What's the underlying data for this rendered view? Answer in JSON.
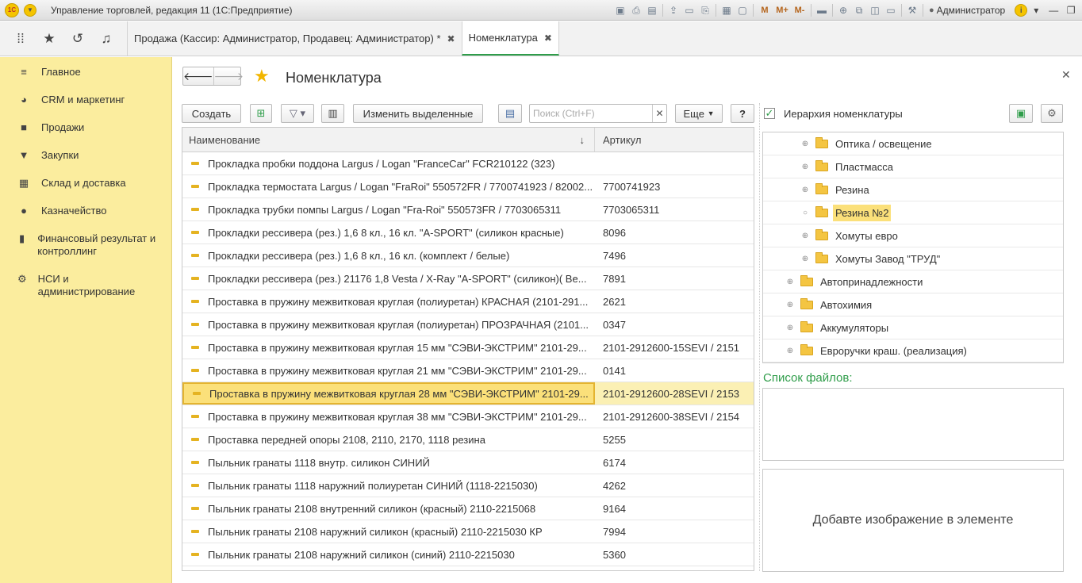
{
  "window": {
    "title": "Управление торговлей, редакция 11  (1С:Предприятие)",
    "user": "Администратор",
    "memory_buttons": [
      "M",
      "M+",
      "M-"
    ]
  },
  "tabs": [
    {
      "label": "Продажа (Кассир: Администратор, Продавец: Администратор) *",
      "active": false
    },
    {
      "label": "Номенклатура",
      "active": true
    }
  ],
  "sidebar": {
    "items": [
      {
        "label": "Главное",
        "icon": "hamburger-icon"
      },
      {
        "label": "CRM и маркетинг",
        "icon": "crm-icon"
      },
      {
        "label": "Продажи",
        "icon": "bag-icon"
      },
      {
        "label": "Закупки",
        "icon": "cart-icon"
      },
      {
        "label": "Склад и доставка",
        "icon": "grid-icon"
      },
      {
        "label": "Казначейство",
        "icon": "ruble-icon"
      },
      {
        "label": "Финансовый результат и контроллинг",
        "icon": "bar-chart-icon"
      },
      {
        "label": "НСИ и администрирование",
        "icon": "gear-icon"
      }
    ]
  },
  "page": {
    "title": "Номенклатура"
  },
  "toolbar": {
    "create_label": "Создать",
    "edit_selected_label": "Изменить выделенные",
    "more_label": "Еще",
    "help_label": "?",
    "search_placeholder": "Поиск (Ctrl+F)"
  },
  "table": {
    "columns": [
      "Наименование",
      "Артикул"
    ],
    "selected_index": 10,
    "rows": [
      {
        "name": "Прокладка пробки поддона Largus / Logan \"FranceCar\" FCR210122 (323)",
        "article": ""
      },
      {
        "name": "Прокладка термостата Largus / Logan \"FraRoi\" 550572FR / 7700741923 / 82002...",
        "article": "7700741923"
      },
      {
        "name": "Прокладка трубки помпы Largus / Logan \"Fra-Roi\" 550573FR / 7703065311",
        "article": "7703065311"
      },
      {
        "name": "Прокладки рессивера (рез.) 1,6 8 кл., 16 кл. \"A-SPORT\" (силикон красные)",
        "article": "8096"
      },
      {
        "name": "Прокладки рессивера (рез.) 1,6 8 кл., 16 кл. (комплект / белые)",
        "article": "7496"
      },
      {
        "name": "Прокладки рессивера (рез.) 21176 1,8 Vesta / X-Ray \"A-SPORT\" (силикон)( Ве...",
        "article": "7891"
      },
      {
        "name": "Проставка в пружину межвитковая круглая (полиуретан) КРАСНАЯ (2101-291...",
        "article": "2621"
      },
      {
        "name": "Проставка в пружину межвитковая круглая (полиуретан) ПРОЗРАЧНАЯ (2101...",
        "article": "0347"
      },
      {
        "name": "Проставка в пружину межвитковая круглая 15 мм \"СЭВИ-ЭКСТРИМ\" 2101-29...",
        "article": "2101-2912600-15SEVI / 2151"
      },
      {
        "name": "Проставка в пружину межвитковая круглая 21 мм \"СЭВИ-ЭКСТРИМ\" 2101-29...",
        "article": "0141"
      },
      {
        "name": "Проставка в пружину межвитковая круглая 28 мм \"СЭВИ-ЭКСТРИМ\" 2101-29...",
        "article": "2101-2912600-28SEVI / 2153"
      },
      {
        "name": "Проставка в пружину межвитковая круглая 38 мм \"СЭВИ-ЭКСТРИМ\" 2101-29...",
        "article": "2101-2912600-38SEVI / 2154"
      },
      {
        "name": "Проставка передней опоры 2108, 2110, 2170, 1118 резина",
        "article": "5255"
      },
      {
        "name": "Пыльник гранаты 1118 внутр. силикон СИНИЙ",
        "article": "6174"
      },
      {
        "name": "Пыльник гранаты 1118 наружний полиуретан СИНИЙ (1118-2215030)",
        "article": "4262"
      },
      {
        "name": "Пыльник гранаты 2108 внутренний силикон (красный) 2110-2215068",
        "article": "9164"
      },
      {
        "name": "Пыльник гранаты 2108 наружний силикон (красный) 2110-2215030 КР",
        "article": "7994"
      },
      {
        "name": "Пыльник гранаты 2108 наружний силикон (синий) 2110-2215030",
        "article": "5360"
      }
    ]
  },
  "hierarchy": {
    "label": "Иерархия номенклатуры",
    "checked": true,
    "nodes": [
      {
        "label": "Оптика / освещение",
        "level": 2,
        "expander": "plus"
      },
      {
        "label": "Пластмасса",
        "level": 2,
        "expander": "plus"
      },
      {
        "label": "Резина",
        "level": 2,
        "expander": "plus"
      },
      {
        "label": "Резина №2",
        "level": 2,
        "expander": "circle",
        "selected": true
      },
      {
        "label": "Хомуты евро",
        "level": 2,
        "expander": "plus"
      },
      {
        "label": "Хомуты Завод \"ТРУД\"",
        "level": 2,
        "expander": "plus"
      },
      {
        "label": "Автопринадлежности",
        "level": 1,
        "expander": "plus"
      },
      {
        "label": "Автохимия",
        "level": 1,
        "expander": "plus"
      },
      {
        "label": "Аккумуляторы",
        "level": 1,
        "expander": "plus"
      },
      {
        "label": "Евроручки краш. (реализация)",
        "level": 1,
        "expander": "plus"
      }
    ]
  },
  "files": {
    "label": "Список файлов:"
  },
  "image": {
    "placeholder": "Добавте изображение в элементе"
  },
  "colors": {
    "sidebar_bg": "#fbed9e",
    "accent_green": "#2f9d4a",
    "selection": "#fbe07a",
    "folder": "#f4c542"
  }
}
